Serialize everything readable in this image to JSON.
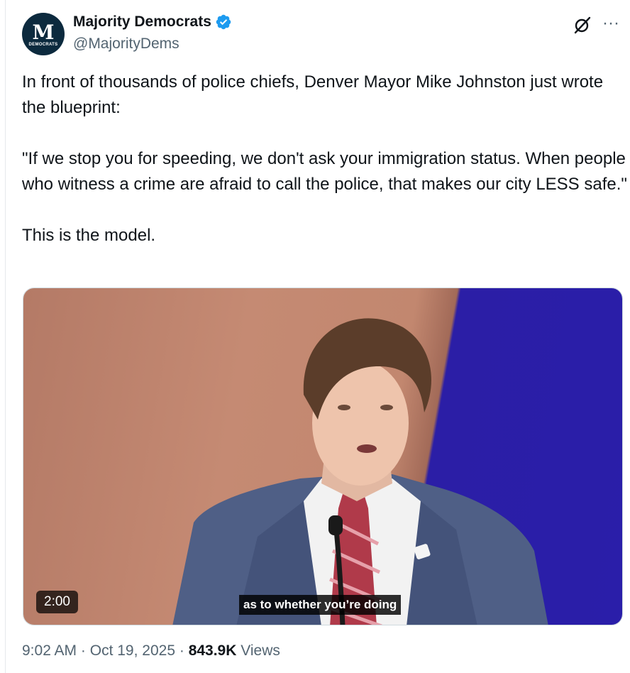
{
  "author": {
    "avatar_letter": "M",
    "avatar_word": "DEMOCRATS",
    "name": "Majority Democrats",
    "handle": "@MajorityDems",
    "verified": true
  },
  "header_icons": [
    "grok-icon",
    "more-icon"
  ],
  "more_glyph": "···",
  "tweet": {
    "paragraphs": [
      "In front of thousands of police chiefs, Denver Mayor Mike Johnston just wrote the blueprint:",
      "\"If we stop you for speeding, we don't ask your immigration status. When people who witness a crime are afraid to call the police, that makes our city LESS safe.\"",
      "This is the model."
    ]
  },
  "video": {
    "duration": "2:00",
    "caption": "as to whether you’re doing"
  },
  "meta": {
    "time": "9:02 AM",
    "separator": "·",
    "date": "Oct 19, 2025",
    "views_count": "843.9K",
    "views_label": "Views"
  },
  "colors": {
    "text": "#0f1419",
    "secondary": "#536471",
    "verified_blue": "#1d9bf0",
    "avatar_bg": "#0c2a3e"
  }
}
